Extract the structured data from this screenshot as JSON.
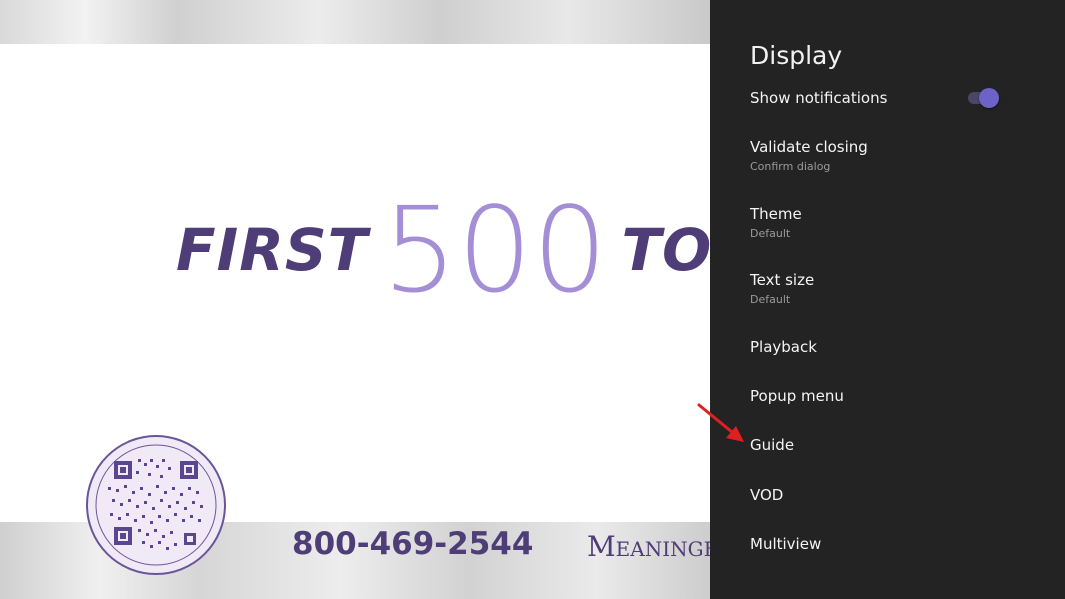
{
  "video": {
    "headline_left": "FIRST",
    "headline_number": "500",
    "headline_right": "TO C",
    "phone": "800-469-2544",
    "brand_partial": "Meaningf"
  },
  "settings": {
    "title": "Display",
    "items": [
      {
        "label": "Show notifications",
        "toggle_on": true
      },
      {
        "label": "Validate closing",
        "sub": "Confirm dialog"
      },
      {
        "label": "Theme",
        "sub": "Default"
      },
      {
        "label": "Text size",
        "sub": "Default"
      },
      {
        "label": "Playback"
      },
      {
        "label": "Popup menu"
      },
      {
        "label": "Guide"
      },
      {
        "label": "VOD"
      },
      {
        "label": "Multiview"
      }
    ]
  },
  "colors": {
    "panel_bg": "#232323",
    "toggle_accent": "#6d62c8",
    "headline_purple": "#4f3d78",
    "number_lavender": "#a48fd6",
    "annotation_arrow": "#e02020"
  },
  "icons": {
    "qr_seal": "qr-code-seal-icon",
    "annotation": "red-arrow-icon"
  }
}
